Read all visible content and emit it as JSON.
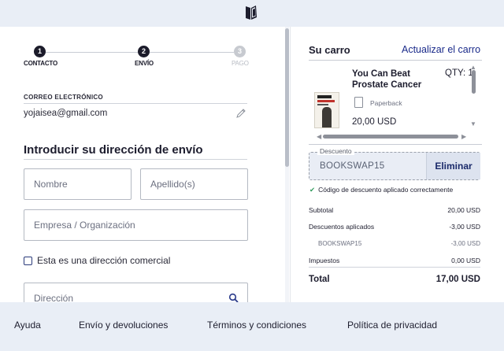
{
  "steps": [
    {
      "number": "1",
      "label": "CONTACTO",
      "state": "done"
    },
    {
      "number": "2",
      "label": "ENVÍO",
      "state": "current"
    },
    {
      "number": "3",
      "label": "PAGO",
      "state": "upcoming"
    }
  ],
  "contact": {
    "email_label": "CORREO ELECTRÓNICO",
    "email_value": "yojaisea@gmail.com"
  },
  "shipping": {
    "title": "Introducir su dirección de envío",
    "first_name_placeholder": "Nombre",
    "last_name_placeholder": "Apellido(s)",
    "company_placeholder": "Empresa / Organización",
    "business_checkbox_label": "Esta es una dirección comercial",
    "address_placeholder": "Dirección"
  },
  "cart": {
    "title": "Su carro",
    "update_link": "Actualizar el carro",
    "item": {
      "title": "You Can Beat Prostate Cancer",
      "qty": "QTY: 1",
      "format": "Paperback",
      "price": "20,00 USD"
    }
  },
  "discount": {
    "label": "Descuento",
    "code": "BOOKSWAP15",
    "remove_button": "Eliminar",
    "success_message": "Código de descuento aplicado correctamente"
  },
  "summary": {
    "subtotal_label": "Subtotal",
    "subtotal_value": "20,00 USD",
    "discounts_label": "Descuentos aplicados",
    "discounts_value": "-3,00 USD",
    "code_label": "BOOKSWAP15",
    "code_value": "-3,00 USD",
    "taxes_label": "Impuestos",
    "taxes_value": "0,00 USD",
    "total_label": "Total",
    "total_value": "17,00 USD"
  },
  "footer": {
    "help": "Ayuda",
    "shipping_returns": "Envío y devoluciones",
    "terms": "Términos y condiciones",
    "privacy": "Política de privacidad"
  },
  "colors": {
    "link": "#1a2a8a",
    "success": "#2e9a5a",
    "page_bg": "#e9eef6"
  }
}
